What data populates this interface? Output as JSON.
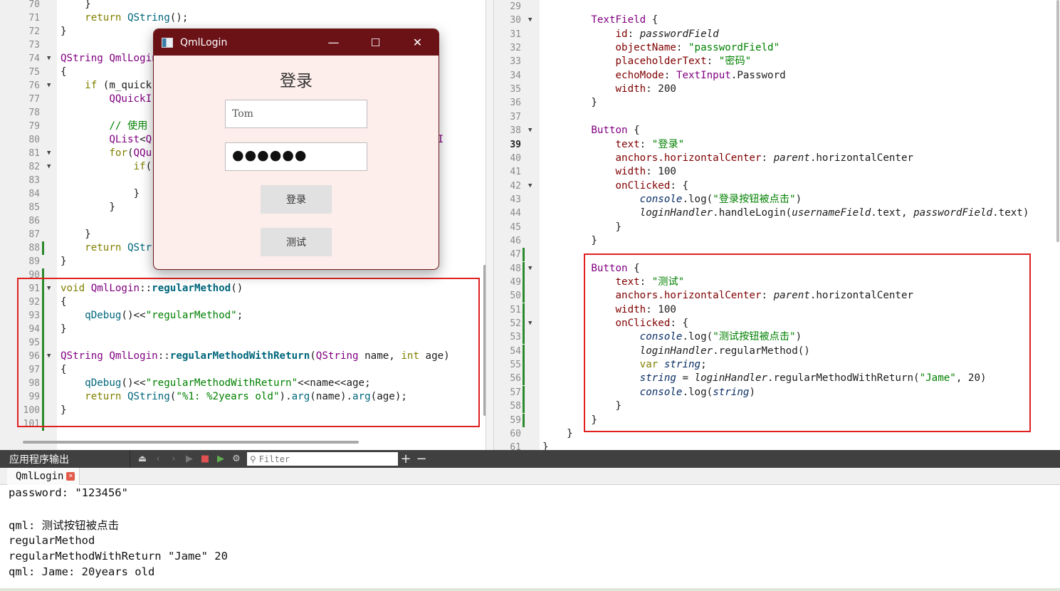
{
  "left_editor": {
    "lines": [
      {
        "n": "70",
        "html": "    }"
      },
      {
        "n": "71",
        "html": "    <span class=\"kw\">return</span> <span class=\"fn\">QString</span>();"
      },
      {
        "n": "72",
        "html": "}"
      },
      {
        "n": "73",
        "html": ""
      },
      {
        "n": "74",
        "html": "<span class=\"ty\">QString</span> <span class=\"ty\">QmlLogin</span>",
        "fold": true
      },
      {
        "n": "75",
        "html": "{"
      },
      {
        "n": "76",
        "html": "    <span class=\"kw\">if</span> (m_quick",
        "fold": true
      },
      {
        "n": "77",
        "html": "        <span class=\"ty\">QQuickI</span>"
      },
      {
        "n": "78",
        "html": ""
      },
      {
        "n": "79",
        "html": "        <span class=\"cm\">// 使用</span>"
      },
      {
        "n": "80",
        "html": "        <span class=\"ty\">QList</span>&lt;<span class=\"ty\">Q</span>                                          <span class=\"ty\">QuickI</span>"
      },
      {
        "n": "81",
        "html": "        <span class=\"kw\">for</span>(<span class=\"ty\">QQu</span>",
        "fold": true
      },
      {
        "n": "82",
        "html": "            <span class=\"kw\">if</span>(",
        "fold": true
      },
      {
        "n": "83",
        "html": ""
      },
      {
        "n": "84",
        "html": "            }"
      },
      {
        "n": "85",
        "html": "        }"
      },
      {
        "n": "86",
        "html": ""
      },
      {
        "n": "87",
        "html": "    }"
      },
      {
        "n": "88",
        "html": "    <span class=\"kw\">return</span> <span class=\"fn\">QStr</span>",
        "chg": true
      },
      {
        "n": "89",
        "html": "}"
      },
      {
        "n": "90",
        "html": "",
        "chg": true
      },
      {
        "n": "91",
        "html": "<span class=\"kw\">void</span> <span class=\"ty\">QmlLogin</span>::<span class=\"fnb\">regularMethod</span>()",
        "fold": true,
        "chg": true
      },
      {
        "n": "92",
        "html": "{",
        "chg": true
      },
      {
        "n": "93",
        "html": "    <span class=\"fn\">qDebug</span>()&lt;&lt;<span class=\"str\">\"regularMethod\"</span>;",
        "chg": true
      },
      {
        "n": "94",
        "html": "}",
        "chg": true
      },
      {
        "n": "95",
        "html": "",
        "chg": true
      },
      {
        "n": "96",
        "html": "<span class=\"ty\">QString</span> <span class=\"ty\">QmlLogin</span>::<span class=\"fnb\">regularMethodWithReturn</span>(<span class=\"ty\">QString</span> name, <span class=\"kw\">int</span> age)",
        "fold": true,
        "chg": true
      },
      {
        "n": "97",
        "html": "{",
        "chg": true
      },
      {
        "n": "98",
        "html": "    <span class=\"fn\">qDebug</span>()&lt;&lt;<span class=\"str\">\"regularMethodWithReturn\"</span>&lt;&lt;name&lt;&lt;age;",
        "chg": true
      },
      {
        "n": "99",
        "html": "    <span class=\"kw\">return</span> <span class=\"fn\">QString</span>(<span class=\"str\">\"%1: %2years old\"</span>).<span class=\"fn\">arg</span>(name).<span class=\"fn\">arg</span>(age);",
        "chg": true
      },
      {
        "n": "100",
        "html": "}",
        "chg": true
      },
      {
        "n": "101",
        "html": "",
        "chg": true
      }
    ]
  },
  "right_editor": {
    "lines": [
      {
        "n": "29",
        "html": ""
      },
      {
        "n": "30",
        "html": "        <span class=\"qmty\">TextField</span> {",
        "fold": true
      },
      {
        "n": "31",
        "html": "            <span class=\"qid\">id</span>: <span class=\"itp\">passwordField</span>"
      },
      {
        "n": "32",
        "html": "            <span class=\"qid\">objectName</span>: <span class=\"str\">\"passwordField\"</span>"
      },
      {
        "n": "33",
        "html": "            <span class=\"qid\">placeholderText</span>: <span class=\"str\">\"密码\"</span>"
      },
      {
        "n": "34",
        "html": "            <span class=\"qid\">echoMode</span>: <span class=\"qmty\">TextInput</span>.Password"
      },
      {
        "n": "35",
        "html": "            <span class=\"qid\">width</span>: 200"
      },
      {
        "n": "36",
        "html": "        }"
      },
      {
        "n": "37",
        "html": ""
      },
      {
        "n": "38",
        "html": "        <span class=\"qmty\">Button</span> {",
        "fold": true
      },
      {
        "n": "39",
        "html": "            <span class=\"qid\">text</span>: <span class=\"str\">\"登录\"</span>",
        "cur": true
      },
      {
        "n": "40",
        "html": "            <span class=\"qid\">anchors.horizontalCenter</span>: <span class=\"itp\">parent</span>.horizontalCenter"
      },
      {
        "n": "41",
        "html": "            <span class=\"qid\">width</span>: 100"
      },
      {
        "n": "42",
        "html": "            <span class=\"qid\">onClicked</span>: {",
        "fold": true
      },
      {
        "n": "43",
        "html": "                <span class=\"it\">console</span>.log(<span class=\"str\">\"登录按钮被点击\"</span>)"
      },
      {
        "n": "44",
        "html": "                <span class=\"itp\">loginHandler</span>.handleLogin(<span class=\"itp\">usernameField</span>.text, <span class=\"itp\">passwordField</span>.text)"
      },
      {
        "n": "45",
        "html": "            }"
      },
      {
        "n": "46",
        "html": "        }"
      },
      {
        "n": "47",
        "html": "",
        "chg": true
      },
      {
        "n": "48",
        "html": "        <span class=\"qmty\">Button</span> {",
        "fold": true,
        "chg": true
      },
      {
        "n": "49",
        "html": "            <span class=\"qid\">text</span>: <span class=\"str\">\"测试\"</span>",
        "chg": true
      },
      {
        "n": "50",
        "html": "            <span class=\"qid\">anchors.horizontalCenter</span>: <span class=\"itp\">parent</span>.horizontalCenter",
        "chg": true
      },
      {
        "n": "51",
        "html": "            <span class=\"qid\">width</span>: 100",
        "chg": true
      },
      {
        "n": "52",
        "html": "            <span class=\"qid\">onClicked</span>: {",
        "fold": true,
        "chg": true
      },
      {
        "n": "53",
        "html": "                <span class=\"it\">console</span>.log(<span class=\"str\">\"测试按钮被点击\"</span>)",
        "chg": true
      },
      {
        "n": "54",
        "html": "                <span class=\"itp\">loginHandler</span>.regularMethod()",
        "chg": true
      },
      {
        "n": "55",
        "html": "                <span class=\"kw\">var</span> <span class=\"it\">string</span>;",
        "chg": true
      },
      {
        "n": "56",
        "html": "                <span class=\"it\">string</span> = <span class=\"itp\">loginHandler</span>.regularMethodWithReturn(<span class=\"str\">\"Jame\"</span>, 20)",
        "chg": true
      },
      {
        "n": "57",
        "html": "                <span class=\"it\">console</span>.log(<span class=\"it\">string</span>)",
        "chg": true
      },
      {
        "n": "58",
        "html": "            }",
        "chg": true
      },
      {
        "n": "59",
        "html": "        }",
        "chg": true
      },
      {
        "n": "60",
        "html": "    }"
      },
      {
        "n": "61",
        "html": "}"
      }
    ]
  },
  "dialog": {
    "window_title": "QmlLogin",
    "heading": "登录",
    "username_value": "Tom",
    "password_mask": "●●●●●●",
    "login_button": "登录",
    "test_button": "测试",
    "minimize": "—",
    "maximize": "☐",
    "close": "✕"
  },
  "output": {
    "pane_title": "应用程序输出",
    "filter_placeholder": "Filter",
    "tab_label": "QmlLogin",
    "lines": [
      "password: \"123456\"",
      "",
      "qml: 测试按钮被点击",
      "regularMethod",
      "regularMethodWithReturn \"Jame\" 20",
      "qml: Jame: 20years old"
    ]
  },
  "colors": {
    "title_bar": "#6b1217",
    "dialog_bg": "#fdedeb",
    "highlight_box": "#e02020",
    "change_bar": "#2c8a2c"
  }
}
